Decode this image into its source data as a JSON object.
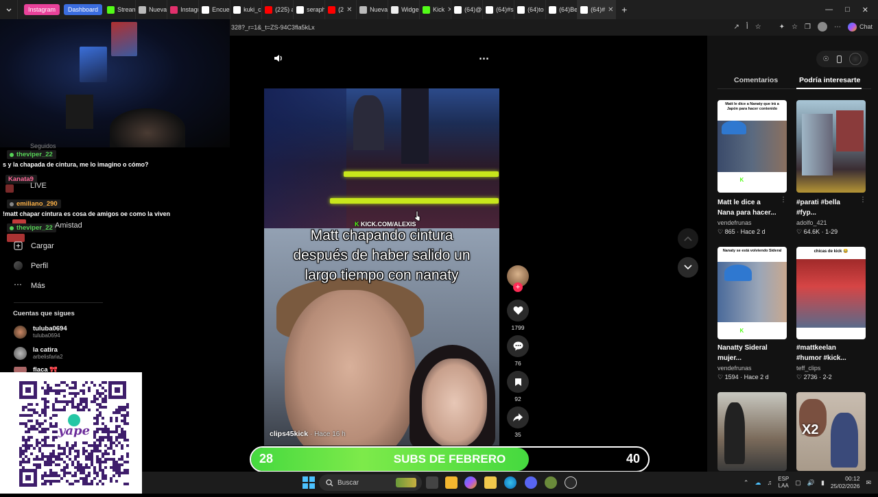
{
  "browser": {
    "tabs": [
      {
        "label": "",
        "color": "#3a3a3a"
      },
      {
        "label": "Instagram",
        "pill": true,
        "color": "#e9429a"
      },
      {
        "label": "Dashboard",
        "pill": true,
        "color": "#3b6ddf"
      },
      {
        "label": "Stream",
        "color": "#53fc18"
      },
      {
        "label": "Nueva",
        "color": "#bbbbbb"
      },
      {
        "label": "Instagr",
        "color": "#e1306c"
      },
      {
        "label": "Encuen",
        "color": "#ffffff"
      },
      {
        "label": "kuki_cl",
        "color": "#ffffff"
      },
      {
        "label": "(225) a",
        "color": "#ff0000"
      },
      {
        "label": "seraph",
        "color": "#ffffff"
      },
      {
        "label": "(2",
        "color": "#ff0000"
      },
      {
        "label": "Nueva",
        "color": "#bbbbbb"
      },
      {
        "label": "Widge",
        "color": "#eeeeee"
      },
      {
        "label": "Kick",
        "color": "#53fc18"
      },
      {
        "label": "(64)@",
        "color": "#ffffff"
      },
      {
        "label": "(64)#s",
        "color": "#ffffff"
      },
      {
        "label": "(64)to",
        "color": "#ffffff"
      },
      {
        "label": "(64)Be",
        "color": "#ffffff"
      },
      {
        "label": "(64)#",
        "color": "#ffffff",
        "active": true
      }
    ],
    "new_tab": "+",
    "url": "328?_r=1&_t=ZS-94C3fla5kLx",
    "chat_label": "Chat"
  },
  "overlay": {
    "chat": [
      {
        "user": "theviper_22",
        "user_color": "#57d357",
        "message": ""
      },
      {
        "user": "",
        "message": "s y la chapada de cintura, me lo imagino o cómo?"
      },
      {
        "user": "Kanata9",
        "user_color": "#ff6b9a",
        "message": ""
      },
      {
        "user": "emiliano_290",
        "user_color": "#ffb347",
        "message": ""
      },
      {
        "user": "",
        "message": "!matt chapar cintura es cosa de amigos oe como la viven"
      },
      {
        "user": "theviper_22",
        "user_color": "#57d357",
        "message": ""
      }
    ],
    "subs": {
      "current": "28",
      "title": "SUBS DE FEBRERO",
      "goal": "40",
      "progress": 0.7
    }
  },
  "tiktok_nav": {
    "live": "LIVE",
    "behind_overlay_1": "Seguidos",
    "behind_overlay_2": "Amistad",
    "upload": "Cargar",
    "profile": "Perfil",
    "more": "Más",
    "following_header": "Cuentas que sigues",
    "following": [
      {
        "name": "tuluba0694",
        "handle": "tuluba0694"
      },
      {
        "name": "la catira",
        "handle": "arbelisfaria2"
      },
      {
        "name": "flaca 🎀",
        "handle": ""
      }
    ]
  },
  "video": {
    "watermark": "KICK.COM/ALEXIS",
    "caption": "Matt chapando cintura después de haber salido un largo tiempo con nanaty",
    "author": "clips45kick",
    "time": "· Hace 16 h",
    "likes": "1799",
    "comments": "76",
    "saves": "92",
    "shares": "35"
  },
  "side": {
    "tabs": [
      "Comentarios",
      "Podría interesarte"
    ],
    "active_tab": 1,
    "items": [
      {
        "overlay": "Matt le dice a Nanaty que irá a Japón para hacer contenido",
        "kick_tag": "/nanaty",
        "caption_1": "Matt le dice a",
        "caption_2": "Nana para hacer...",
        "user": "vendefrunas",
        "likes": "865",
        "date": "Hace 2 d"
      },
      {
        "overlay": "",
        "kick_tag": "",
        "caption_1": "#parati #bella",
        "caption_2": "#fyp...",
        "user": "adolfo_421",
        "likes": "64.6K",
        "date": "1-29"
      },
      {
        "overlay": "Nanaty se está volviendo Sideral",
        "kick_tag": "/nanaty",
        "caption_1": "Nanatty Sideral",
        "caption_2": "mujer...",
        "user": "vendefrunas",
        "likes": "1594",
        "date": "Hace 2 d"
      },
      {
        "overlay": "chicas de kick 😂",
        "kick_tag": "",
        "caption_1": "#mattkeelan",
        "caption_2": "#humor #kick...",
        "user": "teff_clips",
        "likes": "2736",
        "date": "2-2"
      },
      {
        "overlay": "",
        "kick_tag": "",
        "caption_1": "",
        "caption_2": "",
        "user": "",
        "likes": "",
        "date": ""
      },
      {
        "overlay": "X2",
        "kick_tag": "",
        "caption_1": "",
        "caption_2": "",
        "user": "",
        "likes": "",
        "date": ""
      }
    ]
  },
  "taskbar": {
    "search_placeholder": "Buscar",
    "lang_1": "ESP",
    "lang_2": "LAA",
    "time": "00:12",
    "date": "25/02/2026"
  },
  "colors": {
    "accent_red": "#fe2c55",
    "kick_green": "#53fc18",
    "subs_green": "#45d93f"
  }
}
